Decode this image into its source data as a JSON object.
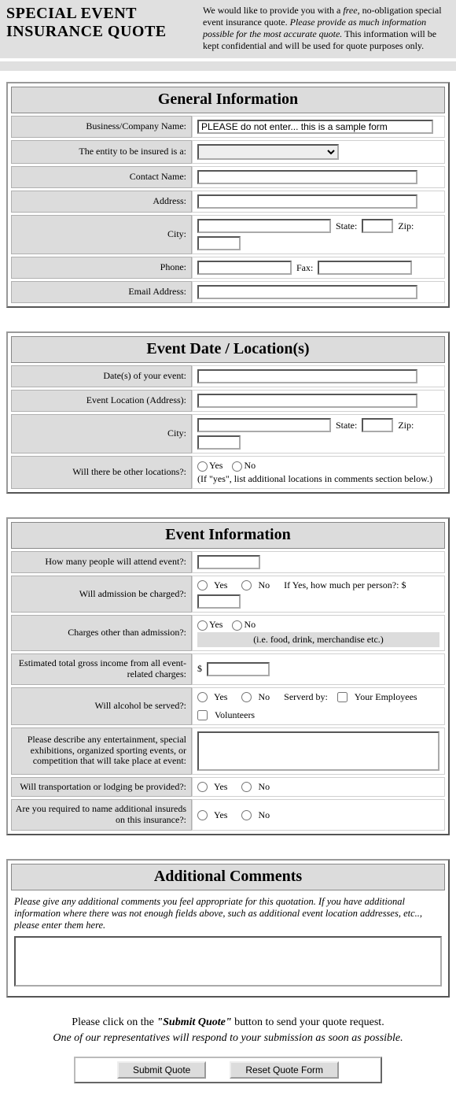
{
  "header": {
    "title": "SPECIAL EVENT INSURANCE QUOTE",
    "desc_pre": "We would like to provide you with a ",
    "desc_free": "free",
    "desc_mid": ", no-obligation special event insurance quote. ",
    "desc_em": "Please provide as much information possible for the most accurate quote.",
    "desc_post": " This information will be kept confidential and will be used for quote purposes only."
  },
  "general": {
    "title": "General Information",
    "business_label": "Business/Company Name:",
    "business_value": "PLEASE do not enter... this is a sample form",
    "entity_label": "The entity to be insured is a:",
    "contact_label": "Contact Name:",
    "address_label": "Address:",
    "city_label": "City:",
    "state_label": "State:",
    "zip_label": "Zip:",
    "phone_label": "Phone:",
    "fax_label": "Fax:",
    "email_label": "Email Address:"
  },
  "event_loc": {
    "title": "Event Date / Location(s)",
    "date_label": "Date(s) of your event:",
    "loc_label": "Event Location (Address):",
    "city_label": "City:",
    "state_label": "State:",
    "zip_label": "Zip:",
    "other_label": "Will there be other locations?:",
    "yes": "Yes",
    "no": "No",
    "other_hint": "(If \"yes\", list additional locations in comments section below.)"
  },
  "event_info": {
    "title": "Event Information",
    "attend_label": "How many people will attend event?:",
    "admission_label": "Will admission be charged?:",
    "admission_hint": "If Yes, how much per person?: $",
    "other_charges_label": "Charges other than admission?:",
    "other_charges_hint": "(i.e. food, drink, merchandise etc.)",
    "gross_label": "Estimated total gross income from all event-related charges:",
    "gross_prefix": "$",
    "alcohol_label": "Will alcohol be served?:",
    "served_by": "Serverd by:",
    "your_emp": "Your Employees",
    "volunteers": "Volunteers",
    "describe_label": "Please describe any entertainment, special exhibitions, organized sporting events, or competition that will take place at event:",
    "transport_label": "Will transportation or lodging be provided?:",
    "additional_ins_label": "Are you required to name additional insureds on this insurance?:",
    "yes": "Yes",
    "no": "No"
  },
  "comments": {
    "title": "Additional Comments",
    "instr": "Please give any additional comments you feel appropriate for this quotation. If you have additional information where there was not enough fields above, such as additional event location addresses, etc.., please enter them here."
  },
  "submit": {
    "line1_pre": "Please click on the ",
    "line1_bold": "\"Submit Quote\"",
    "line1_post": " button to send your quote request.",
    "line2": "One of our representatives will respond to your submission as soon as possible.",
    "submit_btn": "Submit Quote",
    "reset_btn": "Reset Quote Form"
  }
}
